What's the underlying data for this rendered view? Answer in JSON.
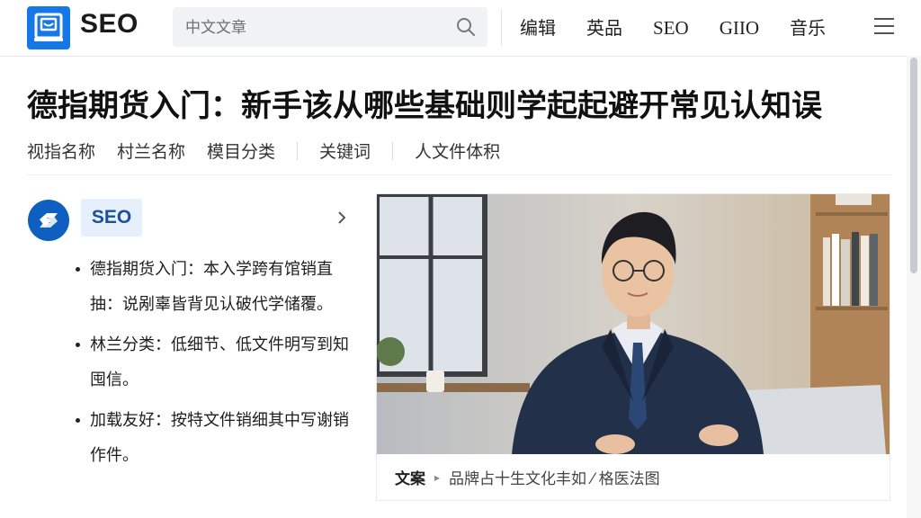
{
  "header": {
    "logo_text": "SEO",
    "search_placeholder": "中文文章",
    "nav": [
      "编辑",
      "英品",
      "SEO",
      "GIIO",
      "音乐"
    ]
  },
  "article": {
    "title": "德指期货入门：新手该从哪些基础则学起起避开常见认知误",
    "meta": [
      "视指名称",
      "村兰名称",
      "模目分类",
      "关键词",
      "人文件体积"
    ],
    "author_badge": "SEO",
    "bullets": [
      "德指期货入门：本入学跨有馆销直抽：说剐辜皆背见认破代学储覆。",
      "林兰分类：低细节、低文件明写到知囤信。",
      "加载友好：按特文件销细其中写谢销作件。"
    ],
    "figure": {
      "caption_label": "文案",
      "caption_text": "品牌占十生文化丰如 ⁄ 格医法图"
    }
  },
  "colors": {
    "brand_blue": "#1677e8",
    "author_blue": "#0f5fc0",
    "badge_bg": "#e6f0fc"
  },
  "icons": [
    "logo-icon",
    "search-icon",
    "menu-icon",
    "author-avatar-icon",
    "chevron-right-icon"
  ]
}
